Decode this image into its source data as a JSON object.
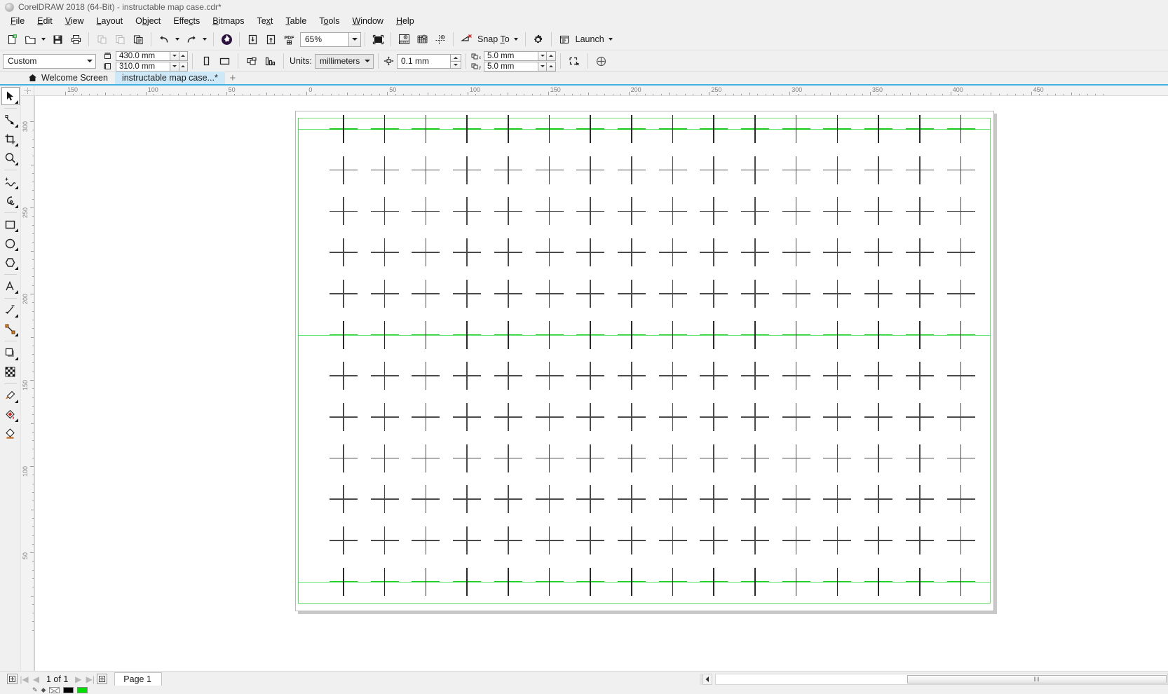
{
  "window": {
    "title": "CorelDRAW 2018 (64-Bit) - instructable map case.cdr*",
    "app_icon": "coreldraw-balloon-icon"
  },
  "menubar": {
    "items": [
      {
        "label": "File"
      },
      {
        "label": "Edit"
      },
      {
        "label": "View"
      },
      {
        "label": "Layout"
      },
      {
        "label": "Object"
      },
      {
        "label": "Effects"
      },
      {
        "label": "Bitmaps"
      },
      {
        "label": "Text"
      },
      {
        "label": "Table"
      },
      {
        "label": "Tools"
      },
      {
        "label": "Window"
      },
      {
        "label": "Help"
      }
    ]
  },
  "toolbar": {
    "buttons": [
      {
        "name": "new-document-button",
        "icon": "new-page-icon"
      },
      {
        "name": "open-document-button",
        "icon": "folder-open-icon"
      },
      {
        "name": "save-document-button",
        "icon": "floppy-disk-icon"
      },
      {
        "name": "print-button",
        "icon": "printer-icon"
      },
      {
        "name": "cut-button",
        "icon": "cut-icon"
      },
      {
        "name": "copy-button",
        "icon": "copy-icon"
      },
      {
        "name": "paste-button",
        "icon": "paste-icon"
      },
      {
        "name": "undo-button",
        "icon": "undo-arrow-icon"
      },
      {
        "name": "redo-button",
        "icon": "redo-arrow-icon"
      },
      {
        "name": "search-content-button",
        "icon": "corel-connect-globe-icon"
      },
      {
        "name": "import-button",
        "icon": "import-down-arrow-icon"
      },
      {
        "name": "export-button",
        "icon": "export-up-arrow-icon"
      },
      {
        "name": "publish-pdf-button",
        "icon": "pdf-icon"
      }
    ],
    "zoom_level": "65%",
    "fullscreen_name": "full-screen-preview-button",
    "view_buttons": [
      {
        "name": "show-rulers-button",
        "icon": "ruler-icon"
      },
      {
        "name": "show-grid-button",
        "icon": "grid-icon"
      },
      {
        "name": "show-guidelines-button",
        "icon": "guidelines-icon"
      }
    ],
    "snap_off_name": "snap-off-button",
    "snap_to_label": "Snap To",
    "options_name": "options-gear-button",
    "launch_label": "Launch"
  },
  "propertybar": {
    "page_preset": "Custom",
    "page_width": "430.0 mm",
    "page_height": "310.0 mm",
    "portrait_name": "portrait-orientation-button",
    "landscape_name": "landscape-orientation-button",
    "all_pages_name": "all-pages-button",
    "current_page_name": "current-page-only-button",
    "units_label": "Units:",
    "units_value": "millimeters",
    "nudge_value": "0.1 mm",
    "duplicate_x": "5.0 mm",
    "duplicate_y": "5.0 mm",
    "edit_pixels_name": "edit-pixels-button",
    "options_name": "property-options-button"
  },
  "tabs": {
    "items": [
      {
        "label": "Welcome Screen",
        "icon": "home-icon",
        "active": false
      },
      {
        "label": "instructable map case...*",
        "icon": "",
        "active": true
      }
    ],
    "new_tab_label": "+"
  },
  "toolbox": {
    "tools": [
      {
        "name": "pick-tool",
        "icon": "arrow-cursor-icon",
        "selected": true,
        "flyout": true
      },
      {
        "name": "shape-tool",
        "icon": "node-edit-icon",
        "selected": false,
        "flyout": true
      },
      {
        "name": "crop-tool",
        "icon": "crop-icon",
        "selected": false,
        "flyout": true
      },
      {
        "name": "zoom-tool",
        "icon": "magnifier-icon",
        "selected": false,
        "flyout": true
      },
      {
        "name": "freehand-tool",
        "icon": "freehand-curve-icon",
        "selected": false,
        "flyout": true
      },
      {
        "name": "artistic-media-tool",
        "icon": "artistic-media-icon",
        "selected": false,
        "flyout": true
      },
      {
        "name": "rectangle-tool",
        "icon": "rectangle-icon",
        "selected": false,
        "flyout": true
      },
      {
        "name": "ellipse-tool",
        "icon": "ellipse-icon",
        "selected": false,
        "flyout": true
      },
      {
        "name": "polygon-tool",
        "icon": "polygon-icon",
        "selected": false,
        "flyout": true
      },
      {
        "name": "text-tool",
        "icon": "letter-a-icon",
        "selected": false,
        "flyout": true
      },
      {
        "name": "parallel-dimension-tool",
        "icon": "dimension-line-icon",
        "selected": false,
        "flyout": true
      },
      {
        "name": "straight-line-connector-tool",
        "icon": "connector-line-icon",
        "selected": false,
        "flyout": true
      },
      {
        "name": "drop-shadow-tool",
        "icon": "drop-shadow-icon",
        "selected": false,
        "flyout": true
      },
      {
        "name": "transparency-tool",
        "icon": "checkerboard-transparency-icon",
        "selected": false,
        "flyout": false
      },
      {
        "name": "color-eyedropper-tool",
        "icon": "eyedropper-icon",
        "selected": false,
        "flyout": true
      },
      {
        "name": "interactive-fill-tool",
        "icon": "paint-bucket-fill-icon",
        "selected": false,
        "flyout": true
      },
      {
        "name": "smart-fill-tool",
        "icon": "smart-fill-icon",
        "selected": false,
        "flyout": false
      }
    ]
  },
  "rulers": {
    "unit": "millimeters",
    "horizontal_labels": [
      "150",
      "100",
      "50",
      "0",
      "50",
      "100",
      "150",
      "200",
      "250",
      "300",
      "350",
      "400",
      "450"
    ],
    "vertical_labels": [
      "300",
      "250",
      "200",
      "150",
      "100",
      "50"
    ]
  },
  "canvas": {
    "page_size": "430.0 mm x 310.0 mm",
    "grid_columns": 16,
    "grid_rows": 12,
    "cross_color": "#4a4a4a",
    "selected_cross_color": "#16c916",
    "guide_color": "#49e05a",
    "page_outline_color": "#6ddc6d",
    "highlighted_rows": [
      0,
      5,
      11
    ]
  },
  "statusbar": {
    "first_page_name": "insert-page-before-button",
    "goto_first_label": "|◀",
    "prev_label": "◀",
    "page_count_label": "1 of 1",
    "next_label": "▶",
    "goto_last_label": "▶|",
    "last_page_name": "insert-page-after-button",
    "page_tab_label": "Page 1",
    "hscroll_grip": "‖‖"
  },
  "colorstrip": {
    "outline_swatch_label": "none",
    "fill_black": "#000000",
    "fill_green": "#00dd00"
  }
}
